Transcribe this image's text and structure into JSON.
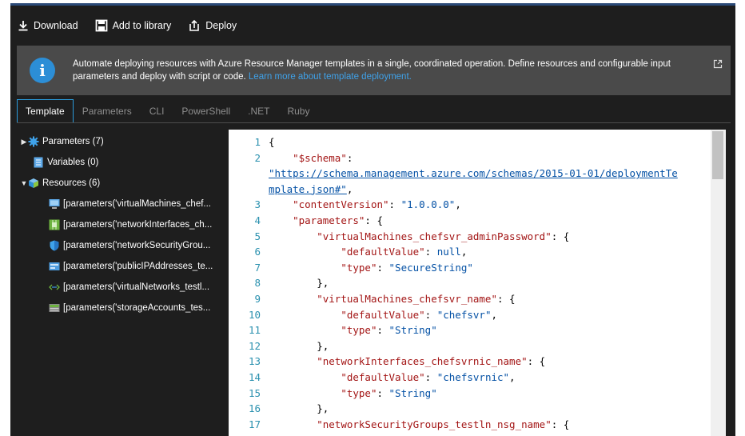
{
  "toolbar": {
    "download": "Download",
    "add_to_library": "Add to library",
    "deploy": "Deploy"
  },
  "banner": {
    "text": "Automate deploying resources with Azure Resource Manager templates in a single, coordinated operation. Define resources and configurable input parameters and deploy with script or code.",
    "link": "Learn more about template deployment."
  },
  "tabs": [
    "Template",
    "Parameters",
    "CLI",
    "PowerShell",
    ".NET",
    "Ruby"
  ],
  "active_tab": "Template",
  "tree": {
    "parameters": "Parameters (7)",
    "variables": "Variables (0)",
    "resources": "Resources (6)",
    "resource_items": [
      {
        "label": "[parameters('virtualMachines_chef...",
        "icon": "virtual-machine-icon"
      },
      {
        "label": "[parameters('networkInterfaces_ch...",
        "icon": "network-interface-icon"
      },
      {
        "label": "[parameters('networkSecurityGrou...",
        "icon": "security-group-icon"
      },
      {
        "label": "[parameters('publicIPAddresses_te...",
        "icon": "public-ip-icon"
      },
      {
        "label": "[parameters('virtualNetworks_testl...",
        "icon": "virtual-network-icon"
      },
      {
        "label": "[parameters('storageAccounts_tes...",
        "icon": "storage-account-icon"
      }
    ]
  },
  "code": {
    "lines": [
      {
        "n": "1",
        "indent": "",
        "key": "",
        "after": "{"
      },
      {
        "n": "2",
        "indent": "    ",
        "key": "\"$schema\"",
        "after": ":"
      },
      {
        "n": "",
        "indent": "",
        "url": "\"https://schema.management.azure.com/schemas/2015-01-01/deploymentTe",
        "after": ""
      },
      {
        "n": "",
        "indent": "",
        "url": "mplate.json#\"",
        "after": ","
      },
      {
        "n": "3",
        "indent": "    ",
        "key": "\"contentVersion\"",
        "after": ": ",
        "val": "\"1.0.0.0\"",
        "tail": ","
      },
      {
        "n": "4",
        "indent": "    ",
        "key": "\"parameters\"",
        "after": ": {"
      },
      {
        "n": "5",
        "indent": "        ",
        "key": "\"virtualMachines_chefsvr_adminPassword\"",
        "after": ": {"
      },
      {
        "n": "6",
        "indent": "            ",
        "key": "\"defaultValue\"",
        "after": ": ",
        "val": "null",
        "tail": ","
      },
      {
        "n": "7",
        "indent": "            ",
        "key": "\"type\"",
        "after": ": ",
        "val": "\"SecureString\"",
        "tail": ""
      },
      {
        "n": "8",
        "indent": "        ",
        "key": "",
        "after": "},"
      },
      {
        "n": "9",
        "indent": "        ",
        "key": "\"virtualMachines_chefsvr_name\"",
        "after": ": {"
      },
      {
        "n": "10",
        "indent": "            ",
        "key": "\"defaultValue\"",
        "after": ": ",
        "val": "\"chefsvr\"",
        "tail": ","
      },
      {
        "n": "11",
        "indent": "            ",
        "key": "\"type\"",
        "after": ": ",
        "val": "\"String\"",
        "tail": ""
      },
      {
        "n": "12",
        "indent": "        ",
        "key": "",
        "after": "},"
      },
      {
        "n": "13",
        "indent": "        ",
        "key": "\"networkInterfaces_chefsvrnic_name\"",
        "after": ": {"
      },
      {
        "n": "14",
        "indent": "            ",
        "key": "\"defaultValue\"",
        "after": ": ",
        "val": "\"chefsvrnic\"",
        "tail": ","
      },
      {
        "n": "15",
        "indent": "            ",
        "key": "\"type\"",
        "after": ": ",
        "val": "\"String\"",
        "tail": ""
      },
      {
        "n": "16",
        "indent": "        ",
        "key": "",
        "after": "},"
      },
      {
        "n": "17",
        "indent": "        ",
        "key": "\"networkSecurityGroups_testln_nsg_name\"",
        "after": ": {"
      }
    ]
  },
  "colors": {
    "blade_bg": "#1e1e1e",
    "banner_bg": "#4a4a4a",
    "accent": "#2b9ad9",
    "link": "#3fa2ea",
    "code_key": "#a31515",
    "code_value": "#0451a5",
    "line_number": "#2b91af"
  }
}
